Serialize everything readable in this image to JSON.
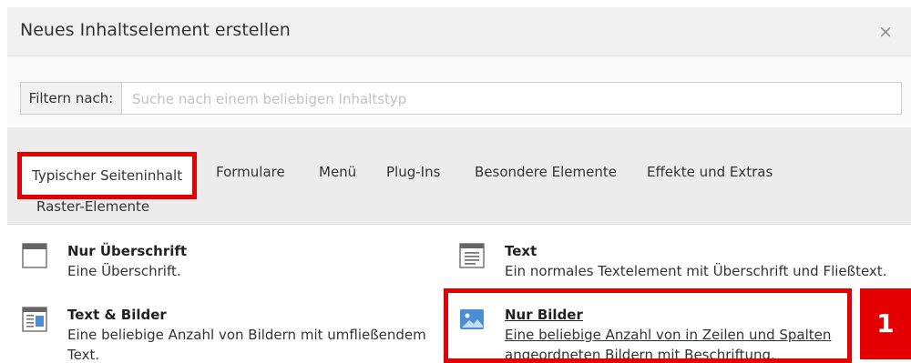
{
  "dialog": {
    "title": "Neues Inhaltselement erstellen",
    "close_glyph": "×"
  },
  "filter": {
    "label": "Filtern nach:",
    "placeholder": "Suche nach einem beliebigen Inhaltstyp",
    "value": ""
  },
  "tabs": [
    {
      "label": "Typischer Seiteninhalt",
      "active": true
    },
    {
      "label": "Formulare"
    },
    {
      "label": "Menü"
    },
    {
      "label": "Plug-Ins"
    },
    {
      "label": "Besondere Elemente"
    },
    {
      "label": "Effekte und Extras"
    },
    {
      "label": "Raster-Elemente"
    }
  ],
  "elements": [
    {
      "title": "Nur Überschrift",
      "description": "Eine Überschrift.",
      "icon": "header-icon"
    },
    {
      "title": "Text",
      "description": "Ein normales Textelement mit Überschrift und Fließtext.",
      "icon": "text-icon"
    },
    {
      "title": "Text & Bilder",
      "description": "Eine beliebige Anzahl von Bildern mit umfließendem Text.",
      "icon": "textpic-icon"
    },
    {
      "title": "Nur Bilder",
      "description": "Eine beliebige Anzahl von in Zeilen und Spalten angeordneten Bildern mit Beschriftung.",
      "icon": "image-icon"
    }
  ],
  "annotation": {
    "badge": "1"
  },
  "colors": {
    "highlight": "#e50000",
    "image_icon": "#4a8fd6"
  }
}
